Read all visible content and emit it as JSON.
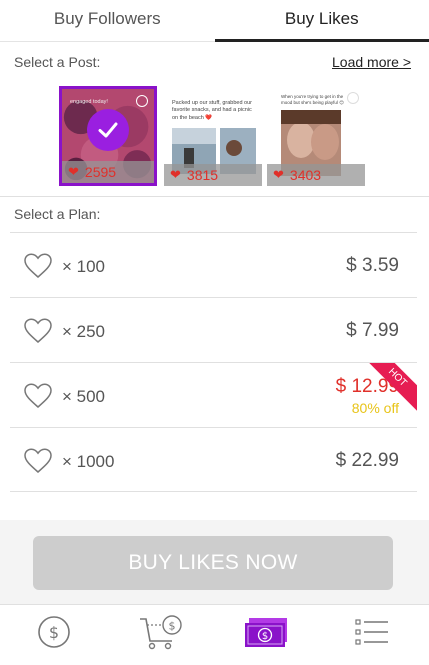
{
  "tabs": [
    {
      "label": "Buy Followers",
      "active": false
    },
    {
      "label": "Buy Likes",
      "active": true
    }
  ],
  "select_post_label": "Select a Post:",
  "load_more_label": "Load more >",
  "posts": [
    {
      "like_count": "2595",
      "selected": true,
      "caption": "engaged today!"
    },
    {
      "like_count": "3815",
      "selected": false,
      "caption": "Packed up our stuff, grabbed our favorite snacks, and had a picnic on the beach ❤️"
    },
    {
      "like_count": "3403",
      "selected": false,
      "caption": "When you're trying to get in the mood but she's being playful 😊"
    }
  ],
  "select_plan_label": "Select a Plan:",
  "plans": [
    {
      "quantity": "× 100",
      "price": "$ 3.59"
    },
    {
      "quantity": "× 250",
      "price": "$ 7.99"
    },
    {
      "quantity": "× 500",
      "price": "$ 12.99",
      "discount": "80% off",
      "badge": "HOT"
    },
    {
      "quantity": "× 1000",
      "price": "$ 22.99"
    }
  ],
  "buy_button_label": "BUY LIKES NOW",
  "colors": {
    "accent_purple": "#8a12c9",
    "hot_red": "#e61d52",
    "price_red": "#e0302a",
    "discount_yellow": "#e8c419",
    "button_gray": "#cdcdcd"
  },
  "bottom_nav": [
    {
      "icon": "dollar-coin-icon",
      "active": false
    },
    {
      "icon": "cart-dollar-icon",
      "active": false
    },
    {
      "icon": "money-bills-icon",
      "active": true
    },
    {
      "icon": "list-icon",
      "active": false
    }
  ]
}
